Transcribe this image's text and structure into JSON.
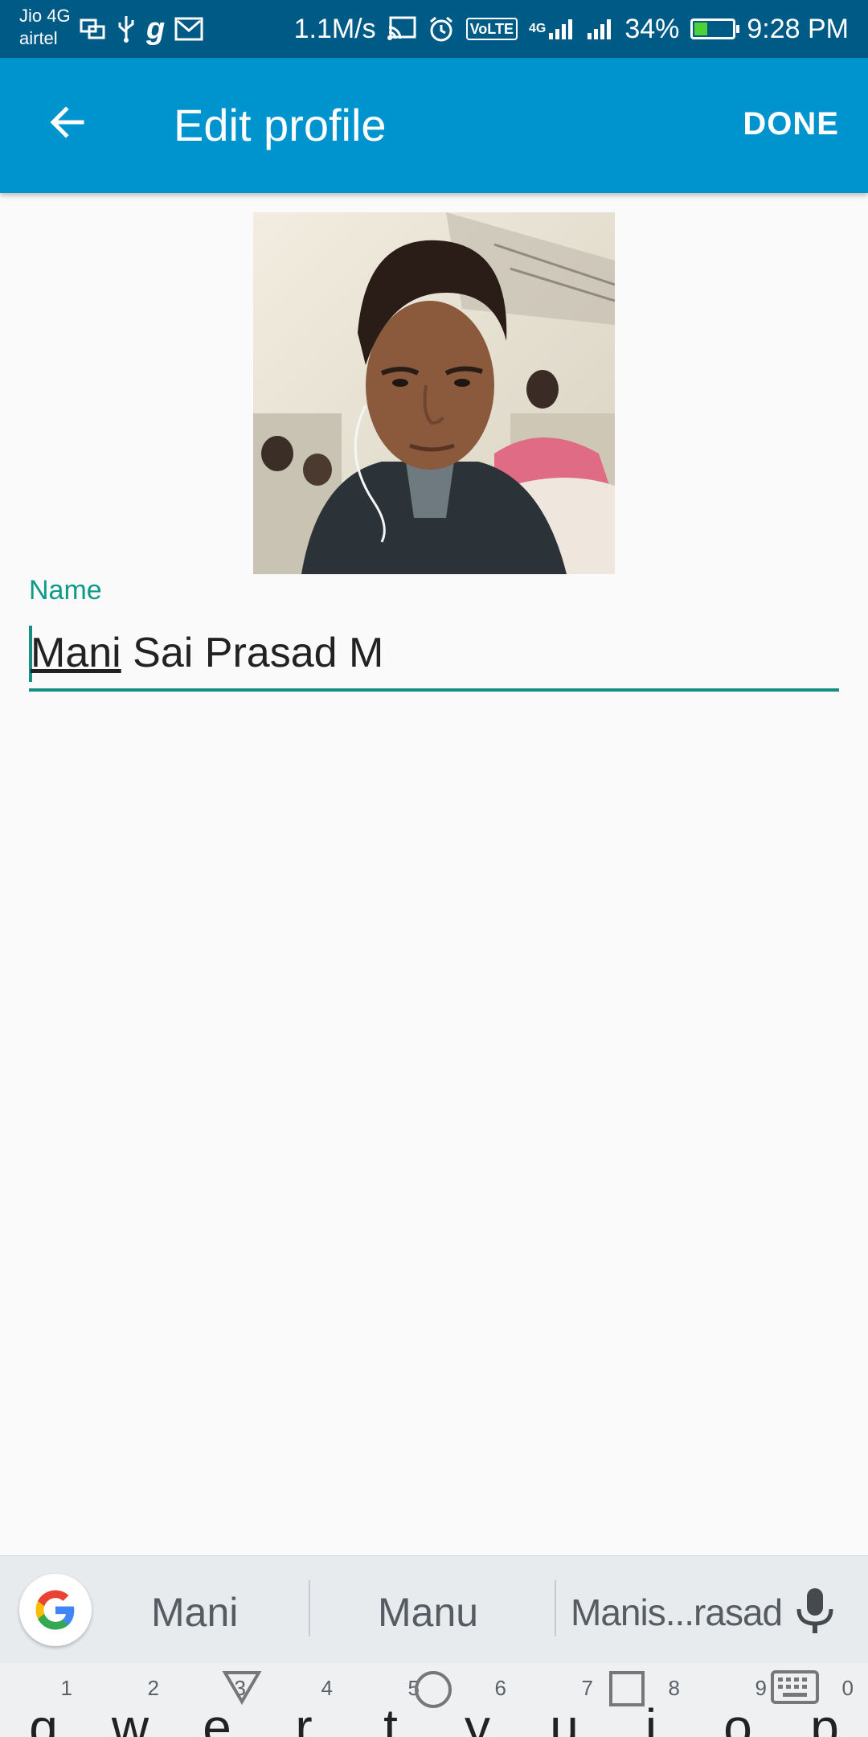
{
  "status_bar": {
    "carrier_top": "Jio 4G",
    "carrier_bottom": "airtel",
    "speed": "1.1M/s",
    "volte": "VoLTE",
    "network_4g": "4G",
    "battery_percent": "34%",
    "battery_level": 0.34,
    "time": "9:28 PM"
  },
  "app_bar": {
    "title": "Edit profile",
    "done_label": "DONE",
    "color": "#0094cf"
  },
  "profile": {
    "name_label": "Name",
    "name_first": "Mani",
    "name_rest": " Sai Prasad M",
    "accent": "#148f82"
  },
  "suggestions": {
    "items": [
      "Mani",
      "Manu",
      "Manis...rasad"
    ]
  },
  "keyboard": {
    "keys": [
      {
        "letter": "q",
        "hint": "1"
      },
      {
        "letter": "w",
        "hint": "2"
      },
      {
        "letter": "e",
        "hint": "3"
      },
      {
        "letter": "r",
        "hint": "4"
      },
      {
        "letter": "t",
        "hint": "5"
      },
      {
        "letter": "y",
        "hint": "6"
      },
      {
        "letter": "u",
        "hint": "7"
      },
      {
        "letter": "i",
        "hint": "8"
      },
      {
        "letter": "o",
        "hint": "9"
      },
      {
        "letter": "p",
        "hint": "0"
      }
    ]
  }
}
